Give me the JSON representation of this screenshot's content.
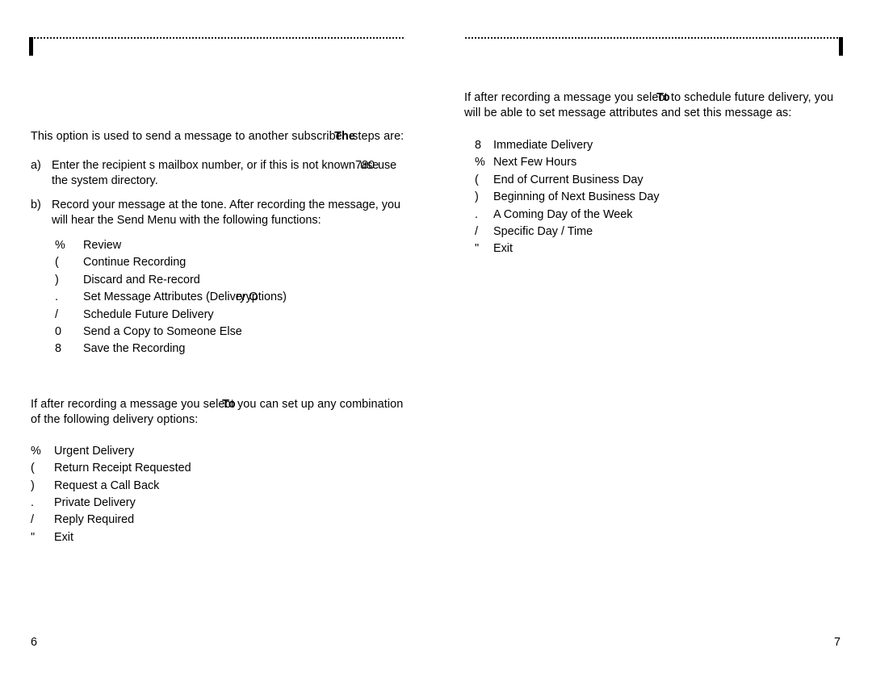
{
  "document": {
    "type": "voice-mail-user-guide",
    "spread": "two-page"
  },
  "left_page": {
    "folio": "6",
    "intro": {
      "before": "This option is used to send a message to another subs",
      "overlap_under": "criber.",
      "overlap_over": "The",
      "after": " steps are:"
    },
    "steps": [
      {
        "marker": "a)",
        "before": "Enter the recipient s mailbox number, or if this is not known",
        "overlap_under": "780",
        "overlap_over": "use",
        "after": " use the system directory."
      },
      {
        "marker": "b)",
        "text": "Record your message at the tone. After recording the message, you will hear the Send Menu with the following functions:"
      }
    ],
    "send_menu": [
      {
        "key": "%",
        "label": "Review"
      },
      {
        "key": "(",
        "label": "Continue Recording"
      },
      {
        "key": ")",
        "label": "Discard and Re-record"
      },
      {
        "key": ".",
        "label": "Set Message Attributes (De",
        "overlap_under": "livery",
        "overlap_over": "ry O",
        "label_after": "ptions)"
      },
      {
        "key": "/",
        "label": "Schedule Future Delivery"
      },
      {
        "key": "0",
        "label": "Send a Copy to Someone Else"
      },
      {
        "key": "8",
        "label": "Save the Recording"
      }
    ],
    "delivery_intro": {
      "before": "If after recording a message you se",
      "overlap_under": "lect",
      "overlap_over": "To",
      "after": " you can set up any combination of the following delivery options:"
    },
    "delivery_options": [
      {
        "key": "%",
        "label": "Urgent Delivery"
      },
      {
        "key": "(",
        "label": "Return Receipt Requested"
      },
      {
        "key": ")",
        "label": "Request a Call Back"
      },
      {
        "key": ".",
        "label": "Private Delivery"
      },
      {
        "key": "/",
        "label": "Reply Required"
      },
      {
        "key": "\"",
        "label": "Exit"
      }
    ]
  },
  "right_page": {
    "folio": "7",
    "schedule_intro": {
      "before": "If after recording a message you se",
      "overlap_under": "lect",
      "overlap_over": "To",
      "after": " to schedule future delivery, you will be able to set message attributes and set this message as:"
    },
    "schedule_options": [
      {
        "key": "8",
        "label": "Immediate Delivery"
      },
      {
        "key": "%",
        "label": "Next Few Hours"
      },
      {
        "key": "(",
        "label": "End of Current Business Day"
      },
      {
        "key": ")",
        "label": "Beginning of Next Business Day"
      },
      {
        "key": ".",
        "label": "A Coming Day of the Week"
      },
      {
        "key": "/",
        "label": "Specific Day / Time"
      },
      {
        "key": "\"",
        "label": "Exit"
      }
    ]
  },
  "colors": {
    "text": "#000000",
    "rule": "#1a1a1a",
    "page": "#ffffff"
  }
}
